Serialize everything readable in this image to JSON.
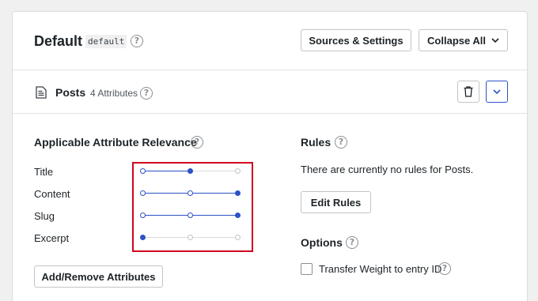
{
  "engine": {
    "title": "Default",
    "slug": "default",
    "buttons": {
      "sources_settings": "Sources & Settings",
      "collapse_all": "Collapse All"
    }
  },
  "source": {
    "title": "Posts",
    "attribute_count": "4 Attributes",
    "icons": {
      "source": "document-icon",
      "delete": "trash-icon",
      "toggle": "chevron-down-icon"
    }
  },
  "relevance": {
    "heading": "Applicable Attribute Relevance",
    "attributes": [
      {
        "label": "Title",
        "level": 2
      },
      {
        "label": "Content",
        "level": 3
      },
      {
        "label": "Slug",
        "level": 3
      },
      {
        "label": "Excerpt",
        "level": 1
      }
    ],
    "max_level": 3,
    "add_remove_button": "Add/Remove Attributes"
  },
  "rules": {
    "heading": "Rules",
    "empty_text": "There are currently no rules for Posts.",
    "edit_button": "Edit Rules"
  },
  "options": {
    "heading": "Options",
    "transfer_weight_label": "Transfer Weight to entry ID",
    "transfer_weight_checked": false
  },
  "colors": {
    "accent": "#2c52c4",
    "highlight_border": "#d0021b",
    "background": "#f0f0f1"
  }
}
